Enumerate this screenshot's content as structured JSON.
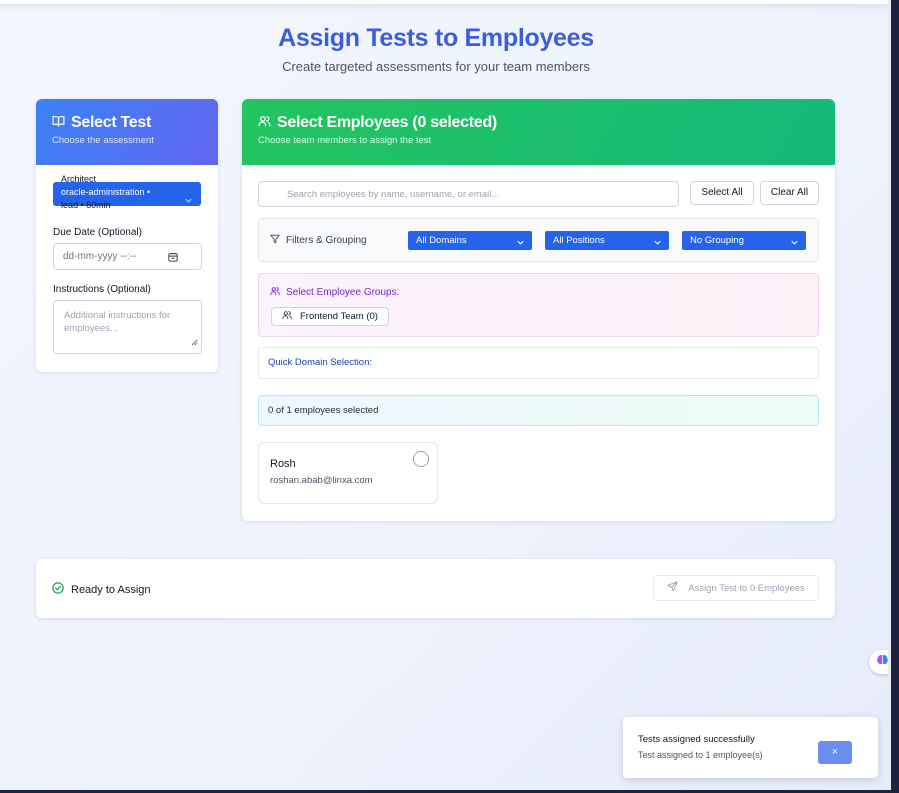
{
  "header": {
    "title": "Assign Tests to Employees",
    "subtitle": "Create targeted assessments for your team members"
  },
  "test_panel": {
    "title": "Select Test",
    "subtitle": "Choose the assessment",
    "selected_test_lines": [
      "Architect",
      "oracle-administration •",
      "lead • 60min"
    ],
    "due_date_label": "Due Date (Optional)",
    "due_date_placeholder": "dd-mm-yyyy --:--",
    "instructions_label": "Instructions (Optional)",
    "instructions_placeholder": "Additional instructions for employees..."
  },
  "employee_panel": {
    "title": "Select Employees (0 selected)",
    "subtitle": "Choose team members to assign the test",
    "search_placeholder": "Search employees by name, username, or email...",
    "select_all_label": "Select All",
    "clear_all_label": "Clear All",
    "filters_label": "Filters & Grouping",
    "filters": {
      "domain": "All Domains",
      "position": "All Positions",
      "grouping": "No Grouping"
    },
    "groups_title": "Select Employee Groups:",
    "groups": [
      {
        "label": "Frontend Team (0)"
      }
    ],
    "quick_domain_label": "Quick Domain Selection:",
    "selection_count": "0 of 1 employees selected",
    "employees": [
      {
        "name": "Rosh",
        "email": "roshan.abab@linxa.com",
        "selected": false
      }
    ]
  },
  "assign_bar": {
    "status": "Ready to Assign",
    "button_label": "Assign Test to 0 Employees"
  },
  "toast": {
    "title": "Tests assigned successfully",
    "message": "Test assigned to 1 employee(s)",
    "close_label": "×"
  },
  "colors": {
    "title_blue": "#3b5fd9",
    "test_header": "#3b82f6",
    "employee_header": "#22c55e",
    "select_blue": "#2563eb",
    "group_purple": "#7e22ce"
  },
  "icons": {
    "test_header": "book-open-icon",
    "employee_header": "users-icon",
    "search": "search-icon",
    "filter": "filter-icon",
    "groups": "users-icon",
    "ready": "check-circle-icon",
    "assign": "send-icon",
    "calendar": "calendar-icon",
    "float_widget": "brain-icon"
  }
}
